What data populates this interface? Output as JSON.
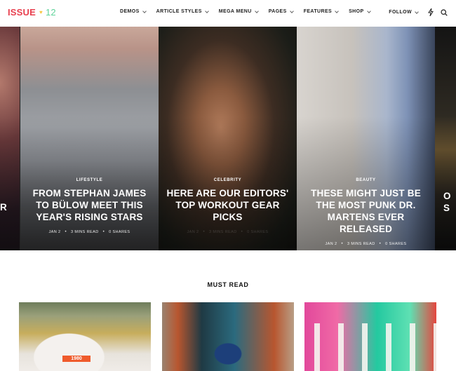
{
  "header": {
    "logo": {
      "word": "ISSUE",
      "heart": "♥",
      "number": "12"
    },
    "nav": [
      {
        "label": "DEMOS"
      },
      {
        "label": "ARTICLE STYLES"
      },
      {
        "label": "MEGA MENU"
      },
      {
        "label": "PAGES"
      },
      {
        "label": "FEATURES"
      },
      {
        "label": "SHOP"
      }
    ],
    "follow_label": "FOLLOW",
    "icons": {
      "bolt": "bolt-icon",
      "search": "search-icon"
    }
  },
  "colors": {
    "logo_red": "#e8404f",
    "logo_yellow": "#f7c744",
    "logo_green": "#5fd39a"
  },
  "slider": {
    "slides": [
      {
        "category": "",
        "title": "ER",
        "meta": {
          "date": "",
          "read": "",
          "shares": ""
        }
      },
      {
        "category": "LIFESTYLE",
        "title": "FROM STEPHAN JAMES TO BÜLOW MEET THIS YEAR'S RISING STARS",
        "meta": {
          "date": "JAN 2",
          "read": "3 MINS READ",
          "shares": "0 SHARES"
        }
      },
      {
        "category": "CELEBRITY",
        "title": "HERE ARE OUR EDITORS' TOP WORKOUT GEAR PICKS",
        "meta": {
          "date": "JAN 2",
          "read": "3 MINS READ",
          "shares": "0 SHARES"
        }
      },
      {
        "category": "BEAUTY",
        "title": "THESE MIGHT JUST BE THE MOST PUNK DR. MARTENS EVER RELEASED",
        "meta": {
          "date": "JAN 2",
          "read": "3 MINS READ",
          "shares": "0 SHARES"
        }
      },
      {
        "category": "",
        "title": "O S",
        "meta": {
          "date": "",
          "read": "",
          "shares": ""
        }
      }
    ],
    "meta_separator": "•"
  },
  "must_read": {
    "title": "MUST READ",
    "cards": [
      {
        "image": "woman-1980-tshirt",
        "tag_text": "1980"
      },
      {
        "image": "woman-blue-top-red-door"
      },
      {
        "image": "group-women-colorful-mural"
      }
    ]
  }
}
